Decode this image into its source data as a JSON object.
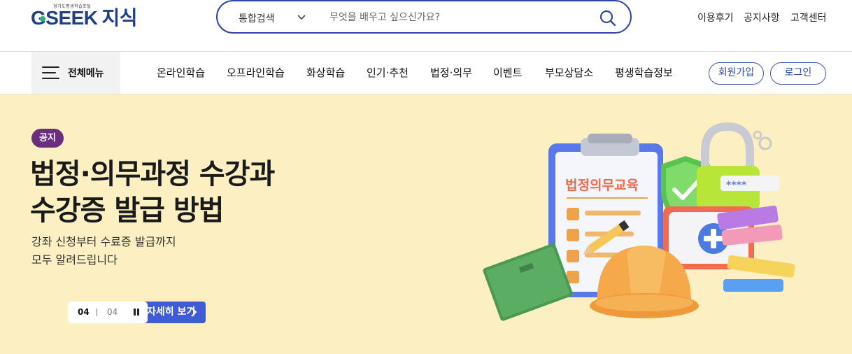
{
  "header": {
    "logo_sub": "경기도평생학습포털",
    "logo_main": "GSEEK",
    "logo_ko": "지식",
    "utility_links": [
      "이용후기",
      "공지사항",
      "고객센터"
    ]
  },
  "search": {
    "category": "통합검색",
    "placeholder": "무엇을 배우고 싶으신가요?"
  },
  "nav": {
    "all_menu_label": "전체메뉴",
    "items": [
      "온라인학습",
      "오프라인학습",
      "화상학습",
      "인기·추천",
      "법정·의무",
      "이벤트",
      "부모상담소",
      "평생학습정보"
    ],
    "signup_label": "회원가입",
    "login_label": "로그인"
  },
  "banner": {
    "badge": "공지",
    "title_line1": "법정·의무과정 수강과",
    "title_line2": "수강증 발급 방법",
    "desc_line1": "강좌 신청부터 수료증 발급까지",
    "desc_line2": "모두 알려드립니다",
    "more_label": "자세히 보기",
    "pager_current": "04",
    "pager_total": "04",
    "illustration_text": "법정의무교육",
    "password_mask": "****",
    "background_color": "#fcefc2"
  },
  "colors": {
    "brand": "#1f3f86",
    "accent": "#3f5bd6",
    "badge": "#6b2d7d"
  }
}
